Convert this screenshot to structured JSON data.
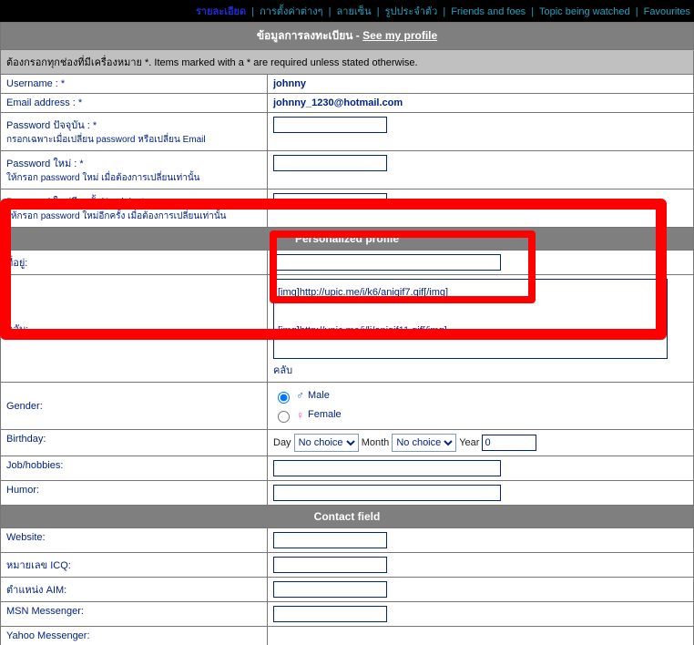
{
  "nav": {
    "details": "รายละเอียด",
    "settings": "การตั้งค่าต่างๆ",
    "signature": "ลายเซ็น",
    "avatar": "รูปประจำตัว",
    "friends": "Friends and foes",
    "watched": "Topic being watched",
    "favourites": "Favourites"
  },
  "headers": {
    "reginfo": "ข้อมูลการลงทะเบียน - ",
    "profile_link": "See my profile",
    "personalized": "Personalized profile",
    "contact": "Contact field"
  },
  "note": "ต้องกรอกทุกช่องที่มีเครื่องหมาย *. Items marked with a * are required unless stated otherwise.",
  "fields": {
    "username_lbl": "Username : *",
    "username_val": "johnny",
    "email_lbl": "Email address : *",
    "email_val": "johnny_1230@hotmail.com",
    "pwcur_lbl": "Password ปัจจุบัน : *",
    "pwcur_hint": "กรอกเฉพาะเมื่อเปลี่ยน password หรือเปลี่ยน Email",
    "pwnew_lbl": "Password ใหม่ : *",
    "pwnew_hint": "ให้กรอก password ใหม่ เมื่อต้องการเปลี่ยนเท่านั้น",
    "pwagain_lbl": "Password ใหม่อีกครั้ง(Again) : *",
    "pwagain_hint": "ให้กรอก password ใหม่อีกครั้ง เมื่อต้องการเปลี่ยนเท่านั้น",
    "location_lbl": "ที่อยู่:",
    "club_lbl": "คลับ:",
    "club_val": "[img]http://upic.me/i/k6/anigif7.gif[/img]\n\n[img]http://upic.me/i/li/anigif11.gif[/img]",
    "club_hint": "คลับ",
    "gender_lbl": "Gender:",
    "gender_male": "Male",
    "gender_female": "Female",
    "birthday_lbl": "Birthday:",
    "day_lbl": "Day",
    "month_lbl": "Month",
    "year_lbl": "Year",
    "nochoice": "No choice",
    "year_val": "0",
    "job_lbl": "Job/hobbies:",
    "humor_lbl": "Humor:",
    "website_lbl": "Website:",
    "icq_lbl": "หมายเลข ICQ:",
    "aim_lbl": "ตำแหน่ง AIM:",
    "msn_lbl": "MSN Messenger:",
    "yahoo_lbl": "Yahoo Messenger:"
  }
}
